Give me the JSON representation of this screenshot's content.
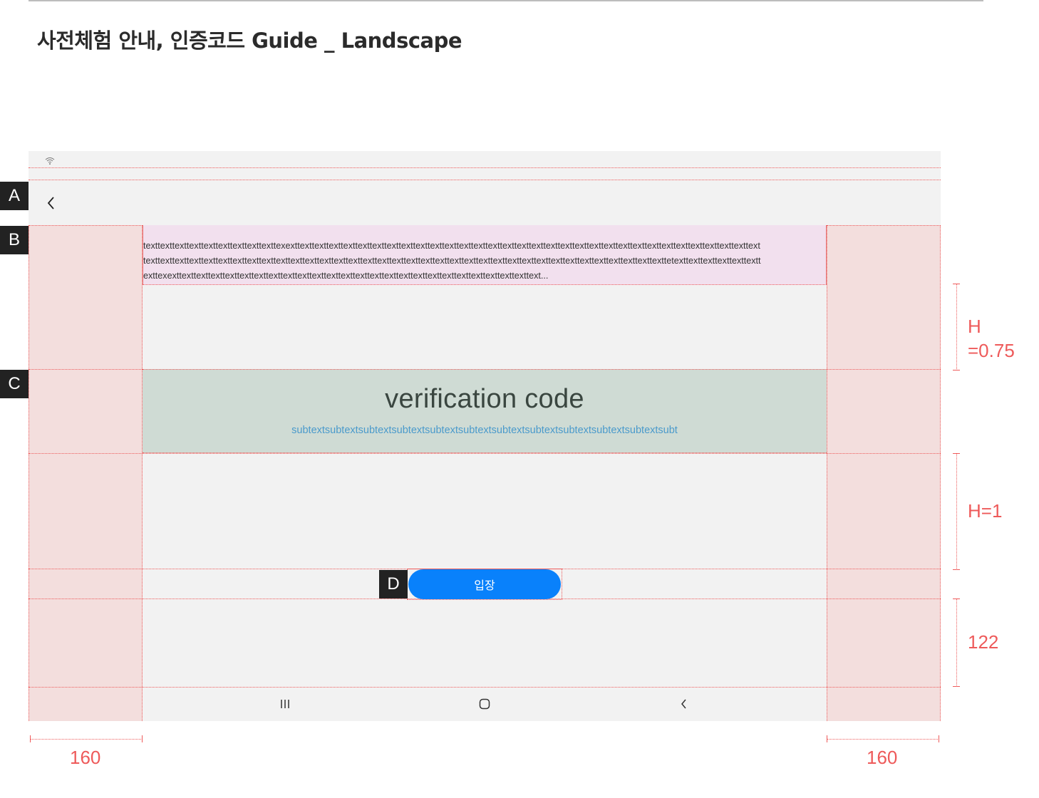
{
  "page_title": "사전체험 안내, 인증코드 Guide _ Landscape",
  "labels": {
    "a": "A",
    "b": "B",
    "c": "C",
    "d": "D"
  },
  "region_b": {
    "lines": [
      "texttexttexttexttexttexttexttexttexttexexttexttexttexttexttexttexttexttexttexttexttexttexttexttexttexttexttexttexttexttexttexttexttexttexttexttexttexttexttexttexttexttext",
      "texttexttexttexttexttexttexttexttexttexttexttexttexttexttexttexttexttexttexttexttexttexttexttexttexttexttexttexttexttexttexttexttexttexttexttexttetexttexttexttexttexttextt",
      "exttexexttexttexttexttexttexttexttexttexttexttexttexttexttexttexttexttexttexttexttexttexttexttexttexttexttext..."
    ]
  },
  "region_c": {
    "title": "verification code",
    "subtitle": "subtextsubtextsubtextsubtextsubtextsubtextsubtextsubtextsubtextsubtextsubtextsubt"
  },
  "enter_button": {
    "label": "입장",
    "color": "#0981fb"
  },
  "dimensions": {
    "h_075_line1": "H",
    "h_075_line2": "=0.75",
    "h_1": "H=1",
    "bottom_gap": "122",
    "margin_left": "160",
    "margin_right": "160"
  },
  "icons": {
    "status": "wifi-icon",
    "back": "chevron-left-icon",
    "nav_recents": "recents-icon",
    "nav_home": "home-icon",
    "nav_back": "nav-back-icon"
  },
  "colors": {
    "guide_red": "#ee5a5a",
    "margin_fill": "#f3dedd",
    "region_b_fill": "#f2e0ee",
    "region_c_fill": "#cfdbd4",
    "subtext": "#4a9acb"
  }
}
